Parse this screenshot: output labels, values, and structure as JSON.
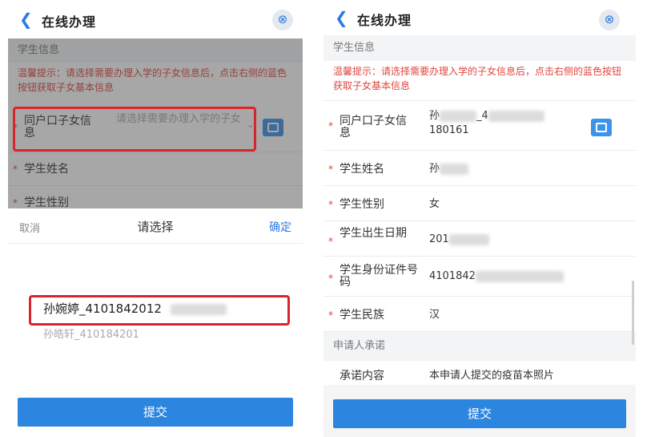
{
  "left": {
    "title": "在线办理",
    "section_student": "学生信息",
    "tip": "温馨提示：请选择需要办理入学的子女信息后，点击右侧的蓝色按钮获取子女基本信息",
    "field_household_child": "同户口子女信息",
    "field_household_child_placeholder": "请选择需要办理入学的子女",
    "field_student_name": "学生姓名",
    "field_student_gender": "学生性别",
    "picker": {
      "cancel": "取消",
      "title": "请选择",
      "confirm": "确定",
      "options": [
        "孙婉婷_4101842012",
        "孙皓轩_410184201"
      ]
    },
    "submit": "提交"
  },
  "right": {
    "title": "在线办理",
    "section_student": "学生信息",
    "tip": "温馨提示：请选择需要办理入学的子女信息后，点击右侧的蓝色按钮获取子女基本信息",
    "fields": [
      {
        "label": "同户口子女信息",
        "value_line1": "孙",
        "value_line1_b": "_4",
        "value_line2": "180161"
      },
      {
        "label": "学生姓名",
        "value": "孙"
      },
      {
        "label": "学生性别",
        "value": "女"
      },
      {
        "label": "学生出生日期",
        "value": "201"
      },
      {
        "label": "学生身份证件号码",
        "value": "4101842"
      },
      {
        "label": "学生民族",
        "value": "汉"
      }
    ],
    "section_applicant": "申请人承诺",
    "commitment_label": "承诺内容",
    "commitment_value": "本申请人提交的疫苗本照片",
    "submit": "提交"
  }
}
